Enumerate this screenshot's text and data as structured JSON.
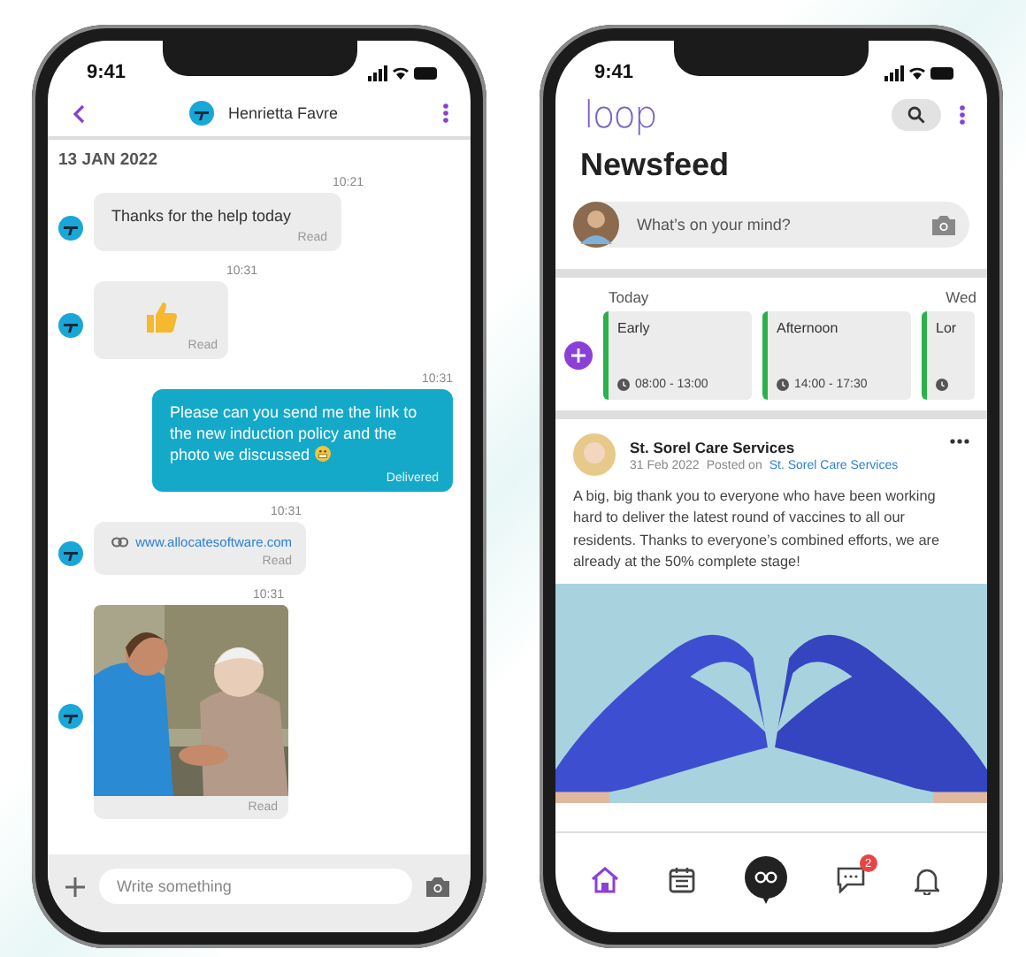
{
  "chat_phone": {
    "status_time": "9:41",
    "contact": "Henrietta Favre",
    "date": "13 JAN 2022",
    "messages": [
      {
        "kind": "text",
        "incoming": true,
        "time": "10:21",
        "text": "Thanks for the help today",
        "status": "Read"
      },
      {
        "kind": "emoji",
        "incoming": true,
        "time": "10:31",
        "status": "Read"
      },
      {
        "kind": "text",
        "incoming": false,
        "time": "10:31",
        "text": "Please can you send me the link to the new induction policy and the photo we discussed",
        "status": "Delivered"
      },
      {
        "kind": "link",
        "incoming": true,
        "time": "10:31",
        "text": "www.allocatesoftware.com",
        "status": "Read"
      },
      {
        "incoming": true,
        "time": "10:31",
        "status": "Read"
      }
    ],
    "composer": {
      "placeholder": "Write something"
    }
  },
  "feed_phone": {
    "status_time": "9:41",
    "logo": "loop",
    "title": "Newsfeed",
    "composer": {
      "placeholder": "What’s on your mind?"
    },
    "day_labels": [
      "Today",
      "Wed"
    ],
    "shifts": [
      {
        "name": "Early",
        "time": "08:00 - 13:00"
      },
      {
        "name": "Afternoon",
        "time": "14:00 - 17:30"
      },
      {
        "name": "Lor"
      }
    ],
    "post": {
      "author": "St. Sorel Care Services",
      "date": "31 Feb 2022",
      "posted_on_label": "Posted on",
      "posted_on": "St. Sorel Care Services",
      "text": "A big, big thank you to everyone who have been working hard to deliver the latest round of vaccines to all our residents. Thanks to everyone’s combined efforts, we are already at the 50% complete stage!"
    },
    "nav": [
      {
        "kind": "home",
        "selected": true
      },
      {
        "kind": "calendar",
        "selected": false
      },
      {
        "kind": "loop",
        "selected": false
      },
      {
        "kind": "chat",
        "selected": false,
        "badge": "2"
      },
      {
        "kind": "bell",
        "selected": false
      }
    ]
  }
}
